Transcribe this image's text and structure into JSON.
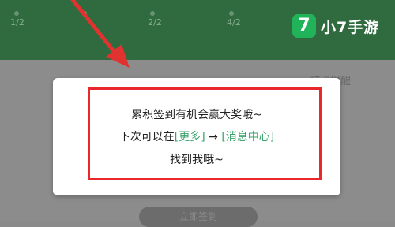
{
  "background": {
    "date_ticks": [
      "1/2",
      "",
      "2/2",
      "4/2",
      ""
    ],
    "behind_text": "打卡提醒",
    "bottom_button": "立即签到"
  },
  "dialog": {
    "line1": "累积签到有机会赢大奖哦~",
    "line2_prefix": "下次可以在",
    "line2_link1": "[更多]",
    "line2_sep": " → ",
    "line2_link2": "[消息中心]",
    "line3": "找到我哦~"
  },
  "logo": {
    "glyph": "7",
    "text": "小7手游"
  },
  "colors": {
    "header_green": "#2f6b3f",
    "highlight_red": "#e8282b",
    "link_green": "#3aa36b",
    "logo_green": "#20b35a"
  }
}
